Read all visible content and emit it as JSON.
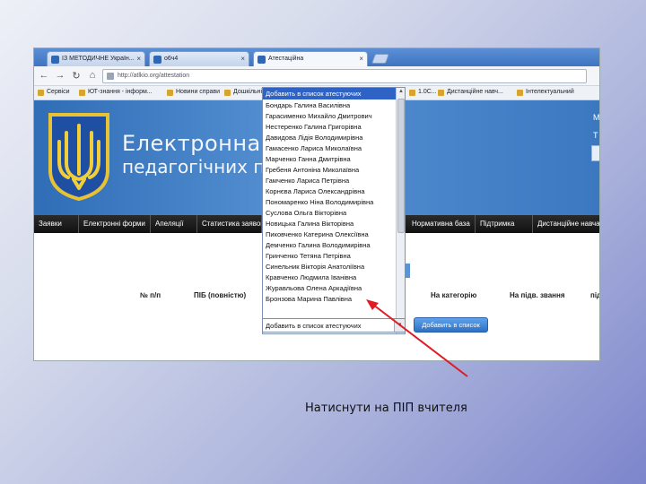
{
  "slide": {
    "caption": "Натиснути на ПІП вчителя"
  },
  "browser": {
    "tabs": [
      {
        "label": "ІЗ МЕТОДИЧНЕ Україн..."
      },
      {
        "label": "о6ч4"
      },
      {
        "label": "Атестаційна"
      }
    ],
    "url": "http://atlkio.org/attestation",
    "bookmarks": [
      "Сервіси",
      "ЮТ-знання - інформ...",
      "Новини справи",
      "Дошкільні...",
      "1.0С...",
      "Дистанційне навч...",
      "Інтелектуальний"
    ]
  },
  "site": {
    "title": "Електронна атестація",
    "subtitle": "педагогічних працівників",
    "side_letters": [
      "М",
      "Т"
    ],
    "menu": [
      "Заявки",
      "Електронні форми",
      "Апеляції",
      "Статистика заявок",
      "Нормативна база",
      "Підтримка",
      "Дистанційне навча"
    ]
  },
  "table": {
    "headers": [
      "№ п/п",
      "ПІБ (повністю)",
      "На категорію",
      "На підв. звання",
      "під"
    ]
  },
  "dropdown": {
    "header": "Добавить в список атестуючих",
    "items": [
      "Бондарь Галина Василівна",
      "Гарасименко Михайло Дмитрович",
      "Нестеренко Галина Григорівна",
      "Давидова Лідія Володимирівна",
      "Гамасенко Лариса Миколаївна",
      "Марченко Ганна Дмитрівна",
      "Гребеня Антоніна Миколаївна",
      "Гамченко Лариса Петрівна",
      "Корнєва Лариса Олександрівна",
      "Пономаренко Ніна Володимирівна",
      "Суслова Ольга Вікторівна",
      "Новицька Галина Вікторівна",
      "Пиковченко Катерина Олексіївна",
      "Демченко Галина Володимирівна",
      "Гринченко Тетяна Петрівна",
      "Синельник Вікторія Анатоліївна",
      "Кравченко Людмила Іванівна",
      "Журавльова Олена Аркадіївна",
      "Бронзова Марина Павлівна"
    ],
    "select_value": "Добавить в список атестуючих",
    "add_button": "Добавить в список"
  },
  "colors": {
    "banner": "#3b78c0",
    "menubar": "#1a1a1a",
    "highlight": "#2e62c4",
    "annotation_arrow": "#e01b24"
  }
}
